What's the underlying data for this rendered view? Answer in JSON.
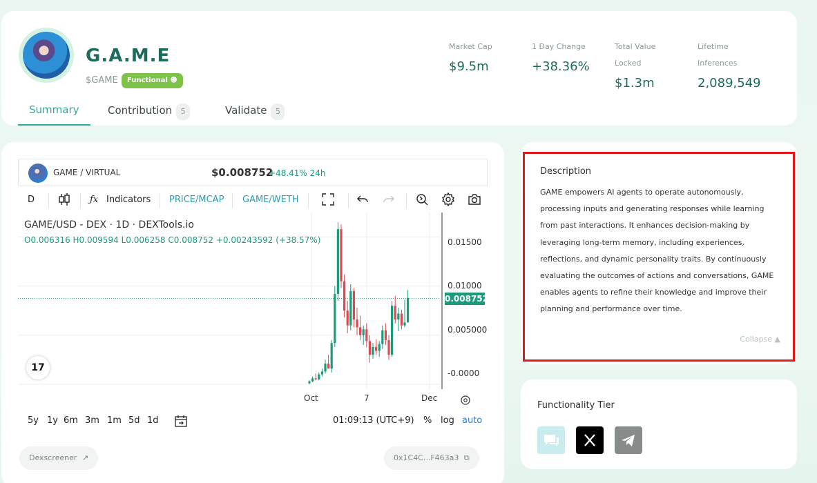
{
  "token": {
    "name": "G.A.M.E",
    "ticker": "$GAME",
    "badge": "Functional"
  },
  "stats": [
    {
      "label": "Market Cap",
      "value": "$9.5m"
    },
    {
      "label": "1 Day Change",
      "value": "+38.36%"
    },
    {
      "label": "Total Value Locked",
      "value": "$1.3m"
    },
    {
      "label": "Lifetime Inferences",
      "value": "2,089,549"
    }
  ],
  "tabs": [
    {
      "label": "Summary",
      "count": ""
    },
    {
      "label": "Contribution",
      "count": "5"
    },
    {
      "label": "Validate",
      "count": "5"
    }
  ],
  "chart_header": {
    "pair": "GAME / VIRTUAL",
    "price": "$0.008752",
    "change": "+48.41% 24h"
  },
  "toolbar": {
    "interval": "D",
    "indicators": "Indicators",
    "price_mcap": "PRICE/MCAP",
    "pair_switch": "GAME/WETH"
  },
  "chart_data": {
    "type": "candlestick",
    "title": "GAME/USD - DEX · 1D · DEXTools.io",
    "ohlc_readout": "O0.006316 H0.009594 L0.006258 C0.008752 +0.00243592 (+38.57%)",
    "y_ticks": [
      "0.01500",
      "0.01000",
      "0.005000",
      "-0.0000"
    ],
    "x_ticks": [
      "Oct",
      "7",
      "Dec"
    ],
    "last_price_label": "0.008752",
    "ylim": [
      -0.0005,
      0.0175
    ],
    "last_price": 0.008752,
    "candles": [
      {
        "o": 0.0001,
        "h": 0.0004,
        "l": 0.0,
        "c": 0.0003
      },
      {
        "o": 0.0003,
        "h": 0.0008,
        "l": 0.0002,
        "c": 0.0006
      },
      {
        "o": 0.0006,
        "h": 0.0011,
        "l": 0.0004,
        "c": 0.0005
      },
      {
        "o": 0.0005,
        "h": 0.0012,
        "l": 0.0004,
        "c": 0.001
      },
      {
        "o": 0.001,
        "h": 0.0016,
        "l": 0.0008,
        "c": 0.0013
      },
      {
        "o": 0.0013,
        "h": 0.0025,
        "l": 0.0011,
        "c": 0.0021
      },
      {
        "o": 0.0021,
        "h": 0.003,
        "l": 0.0018,
        "c": 0.0016
      },
      {
        "o": 0.0016,
        "h": 0.0045,
        "l": 0.0012,
        "c": 0.0042
      },
      {
        "o": 0.0042,
        "h": 0.01,
        "l": 0.0038,
        "c": 0.0092
      },
      {
        "o": 0.0092,
        "h": 0.0165,
        "l": 0.0085,
        "c": 0.0158
      },
      {
        "o": 0.0158,
        "h": 0.0163,
        "l": 0.0098,
        "c": 0.0105
      },
      {
        "o": 0.0105,
        "h": 0.0112,
        "l": 0.0068,
        "c": 0.0075
      },
      {
        "o": 0.0075,
        "h": 0.0085,
        "l": 0.0052,
        "c": 0.006
      },
      {
        "o": 0.006,
        "h": 0.0102,
        "l": 0.0055,
        "c": 0.0095
      },
      {
        "o": 0.0095,
        "h": 0.0098,
        "l": 0.0058,
        "c": 0.0066
      },
      {
        "o": 0.0066,
        "h": 0.0078,
        "l": 0.005,
        "c": 0.0058
      },
      {
        "o": 0.0058,
        "h": 0.007,
        "l": 0.0045,
        "c": 0.005
      },
      {
        "o": 0.005,
        "h": 0.006,
        "l": 0.004,
        "c": 0.0056
      },
      {
        "o": 0.0056,
        "h": 0.0062,
        "l": 0.0038,
        "c": 0.0044
      },
      {
        "o": 0.0044,
        "h": 0.005,
        "l": 0.0022,
        "c": 0.003
      },
      {
        "o": 0.003,
        "h": 0.0042,
        "l": 0.0026,
        "c": 0.0038
      },
      {
        "o": 0.0038,
        "h": 0.0046,
        "l": 0.003,
        "c": 0.0034
      },
      {
        "o": 0.0034,
        "h": 0.0044,
        "l": 0.0028,
        "c": 0.0041
      },
      {
        "o": 0.0041,
        "h": 0.006,
        "l": 0.0036,
        "c": 0.0055
      },
      {
        "o": 0.0055,
        "h": 0.0062,
        "l": 0.004,
        "c": 0.0045
      },
      {
        "o": 0.0045,
        "h": 0.005,
        "l": 0.0025,
        "c": 0.003
      },
      {
        "o": 0.003,
        "h": 0.0085,
        "l": 0.0028,
        "c": 0.008
      },
      {
        "o": 0.008,
        "h": 0.009,
        "l": 0.0062,
        "c": 0.0066
      },
      {
        "o": 0.0066,
        "h": 0.0078,
        "l": 0.0054,
        "c": 0.0072
      },
      {
        "o": 0.0072,
        "h": 0.0076,
        "l": 0.0056,
        "c": 0.006
      },
      {
        "o": 0.006,
        "h": 0.0086,
        "l": 0.0058,
        "c": 0.0063
      },
      {
        "o": 0.0063,
        "h": 0.0096,
        "l": 0.0063,
        "c": 0.0088
      }
    ]
  },
  "time_controls": {
    "ranges": [
      "5y",
      "1y",
      "6m",
      "3m",
      "1m",
      "5d",
      "1d"
    ],
    "clock": "01:09:13 (UTC+9)",
    "percent": "%",
    "log": "log",
    "auto": "auto"
  },
  "links": {
    "dexscreener": "Dexscreener",
    "contract": "0x1C4C...F463a3"
  },
  "description": {
    "title": "Description",
    "text": "GAME empowers AI agents to operate autonomously, processing inputs and generating responses while learning from past interactions. It enhances decision-making by leveraging long-term memory, including experiences, reflections, and dynamic personality traits. By continuously evaluating the outcomes of actions and conversations, GAME enables agents to refine their knowledge and improve their planning and performance over time.",
    "collapse": "Collapse"
  },
  "functionality": {
    "title": "Functionality Tier"
  },
  "colors": {
    "accent": "#33a89c",
    "up": "#1a9b7a",
    "down": "#e0484f",
    "highlight": "#e01818"
  }
}
